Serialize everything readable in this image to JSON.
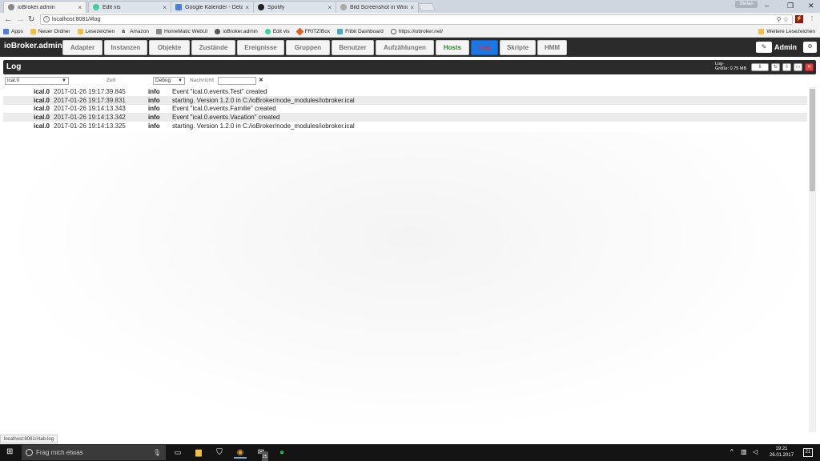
{
  "browser": {
    "tabs": [
      {
        "title": "ioBroker.admin",
        "color": "#888888"
      },
      {
        "title": "Edit vis",
        "color": "#3ecf9a"
      },
      {
        "title": "Google Kalender - Detai",
        "color": "#4a7fe0"
      },
      {
        "title": "Spotify",
        "color": "#222222"
      },
      {
        "title": "Bild Screenshot in Windo",
        "color": "#aaaaaa"
      }
    ],
    "user_badge": "Stefan",
    "window_controls": [
      "–",
      "❐",
      "✕"
    ],
    "url": "localhost:8081/#log",
    "bookmarks": [
      {
        "label": "Apps",
        "color": "#4a7fe0"
      },
      {
        "label": "Neuer Ordner",
        "color": "#f0c040"
      },
      {
        "label": "Lesezeichen",
        "color": "#f0c040"
      },
      {
        "label": "Amazon",
        "color": "#222222"
      },
      {
        "label": "HomeMatic WebUI",
        "color": "#888888"
      },
      {
        "label": "ioBroker.admin",
        "color": "#555555"
      },
      {
        "label": "Edit vis",
        "color": "#3ecf9a"
      },
      {
        "label": "FRITZ!Box",
        "color": "#e06020"
      },
      {
        "label": "Fitbit Dashboard",
        "color": "#44aacc"
      },
      {
        "label": "https://iobroker.net/",
        "color": "#555555"
      }
    ],
    "bookmarks_other": "Weitere Lesezeichen",
    "status_url": "localhost:8081/#tab-log"
  },
  "app": {
    "brand": "ioBroker.admin",
    "nav_tabs": [
      {
        "label": "Adapter"
      },
      {
        "label": "Instanzen"
      },
      {
        "label": "Objekte"
      },
      {
        "label": "Zustände"
      },
      {
        "label": "Ereignisse"
      },
      {
        "label": "Gruppen"
      },
      {
        "label": "Benutzer"
      },
      {
        "label": "Aufzählungen"
      },
      {
        "label": "Hosts"
      },
      {
        "label": "Log"
      },
      {
        "label": "Skripte"
      },
      {
        "label": "HMM"
      }
    ],
    "active_tab": "Log",
    "user_label": "Admin"
  },
  "log": {
    "title": "Log",
    "size_label": "Log-\nGröße: 0.75 MB",
    "pause_label": "II",
    "filters": {
      "source": "ical.0",
      "time_label": "Zeit",
      "severity": "Debug",
      "message_label": "Nachricht",
      "message_value": "",
      "clear": "✖"
    },
    "rows": [
      {
        "source": "ical.0",
        "time": "2017-01-26 19:17:39.845",
        "severity": "info",
        "message": "Event \"ical.0.events.Test\" created"
      },
      {
        "source": "ical.0",
        "time": "2017-01-26 19:17:39.831",
        "severity": "info",
        "message": "starting. Version 1.2.0 in C:/ioBroker/node_modules/iobroker.ical"
      },
      {
        "source": "ical.0",
        "time": "2017-01-26 19:14:13.343",
        "severity": "info",
        "message": "Event \"ical.0.events.Familie\" created"
      },
      {
        "source": "ical.0",
        "time": "2017-01-26 19:14:13.342",
        "severity": "info",
        "message": "Event \"ical.0.events.Vacation\" created"
      },
      {
        "source": "ical.0",
        "time": "2017-01-26 19:14:13.325",
        "severity": "info",
        "message": "starting. Version 1.2.0 in C:/ioBroker/node_modules/iobroker.ical"
      }
    ]
  },
  "taskbar": {
    "search_placeholder": "Frag mich etwas",
    "badge_count": "25",
    "time": "19:21",
    "date": "26.01.2017",
    "notification_count": "21"
  }
}
